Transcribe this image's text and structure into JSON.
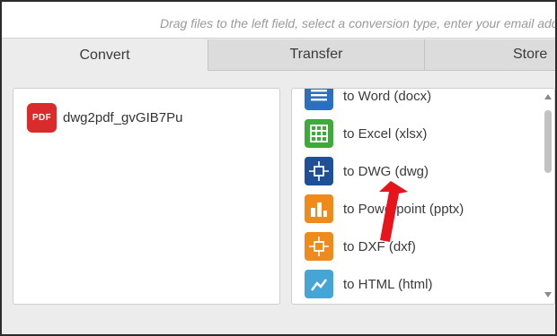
{
  "hint": {
    "text": "Drag files to the left field, select a conversion type, enter your email add"
  },
  "tabs": [
    {
      "label": "Convert",
      "active": true
    },
    {
      "label": "Transfer",
      "active": false
    },
    {
      "label": "Store",
      "active": false
    }
  ],
  "files": [
    {
      "icon": "pdf-icon",
      "icon_text": "PDF",
      "name": "dwg2pdf_gvGIB7Pu"
    }
  ],
  "conversions": [
    {
      "label": "to Word (docx)",
      "icon": "word-icon",
      "color": "#2b6fc1"
    },
    {
      "label": "to Excel (xlsx)",
      "icon": "excel-icon",
      "color": "#3cab3a"
    },
    {
      "label": "to DWG (dwg)",
      "icon": "dwg-icon",
      "color": "#1f4f96"
    },
    {
      "label": "to Powerpoint (pptx)",
      "icon": "powerpoint-icon",
      "color": "#ef8a1c"
    },
    {
      "label": "to DXF (dxf)",
      "icon": "dxf-icon",
      "color": "#ef8a1c"
    },
    {
      "label": "to HTML (html)",
      "icon": "html-icon",
      "color": "#45a6d6"
    }
  ],
  "colors": {
    "annotation_arrow": "#e8141c"
  }
}
